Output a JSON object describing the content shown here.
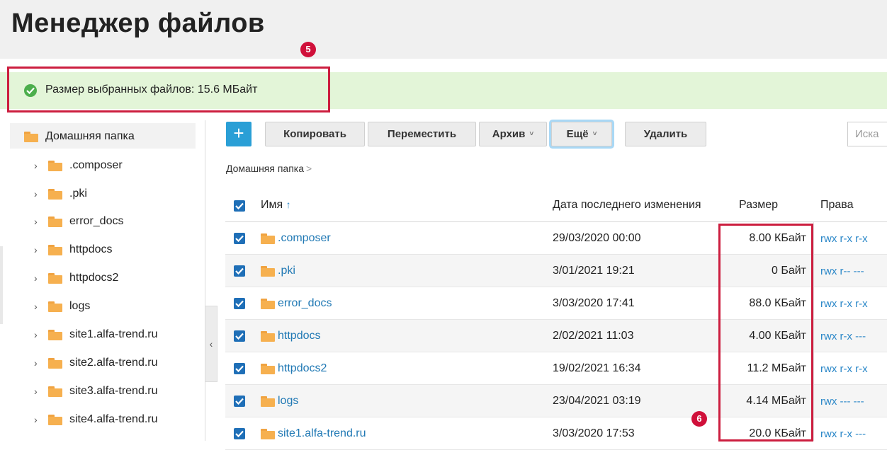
{
  "header": {
    "title": "Менеджер файлов"
  },
  "markers": {
    "m5": "5",
    "m6": "6"
  },
  "notice": {
    "text": "Размер выбранных файлов: 15.6 МБайт",
    "icon": "check-circle-icon",
    "color": "#4cae4c"
  },
  "sidebar": {
    "root": "Домашняя папка",
    "items": [
      {
        "label": ".composer"
      },
      {
        "label": ".pki"
      },
      {
        "label": "error_docs"
      },
      {
        "label": "httpdocs"
      },
      {
        "label": "httpdocs2"
      },
      {
        "label": "logs"
      },
      {
        "label": "site1.alfa-trend.ru"
      },
      {
        "label": "site2.alfa-trend.ru"
      },
      {
        "label": "site3.alfa-trend.ru"
      },
      {
        "label": "site4.alfa-trend.ru"
      }
    ]
  },
  "toolbar": {
    "add_label": "+",
    "copy_label": "Копировать",
    "move_label": "Переместить",
    "archive_label": "Архив",
    "more_label": "Ещё",
    "delete_label": "Удалить",
    "search_placeholder": "Иска"
  },
  "breadcrumb": {
    "current": "Домашняя папка",
    "sep": ">"
  },
  "table": {
    "headers": {
      "name": "Имя",
      "sort_indicator": "↑",
      "date": "Дата последнего изменения",
      "size": "Размер",
      "perms": "Права"
    },
    "rows": [
      {
        "name": ".composer",
        "date": "29/03/2020 00:00",
        "size": "8.00 КБайт",
        "perms": "rwx r-x r-x",
        "checked": true
      },
      {
        "name": ".pki",
        "date": "3/01/2021 19:21",
        "size": "0 Байт",
        "perms": "rwx r-- ---",
        "checked": true
      },
      {
        "name": "error_docs",
        "date": "3/03/2020 17:41",
        "size": "88.0 КБайт",
        "perms": "rwx r-x r-x",
        "checked": true
      },
      {
        "name": "httpdocs",
        "date": "2/02/2021 11:03",
        "size": "4.00 КБайт",
        "perms": "rwx r-x ---",
        "checked": true
      },
      {
        "name": "httpdocs2",
        "date": "19/02/2021 16:34",
        "size": "11.2 МБайт",
        "perms": "rwx r-x r-x",
        "checked": true
      },
      {
        "name": "logs",
        "date": "23/04/2021 03:19",
        "size": "4.14 МБайт",
        "perms": "rwx --- ---",
        "checked": true
      },
      {
        "name": "site1.alfa-trend.ru",
        "date": "3/03/2020 17:53",
        "size": "20.0 КБайт",
        "perms": "rwx r-x ---",
        "checked": true
      }
    ]
  },
  "colors": {
    "accent": "#2a9fd6",
    "link": "#1f78b4",
    "highlight": "#cc1e3f",
    "folder": "#f6b04f"
  }
}
